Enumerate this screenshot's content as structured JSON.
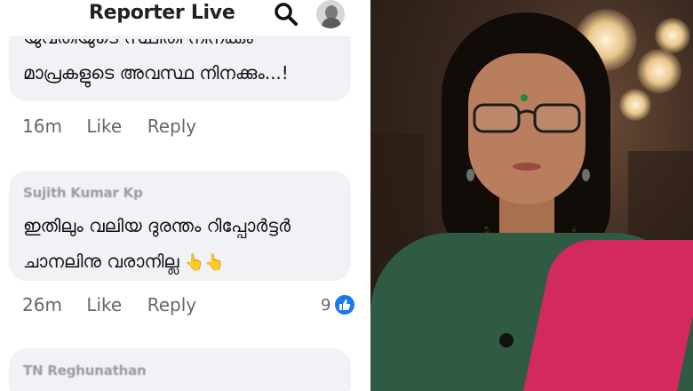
{
  "header": {
    "title": "Reporter Live",
    "search_icon": "search-icon",
    "avatar_icon": "profile-avatar"
  },
  "comments": [
    {
      "author": "",
      "text_cut": "യുവതിയുടെ സ്ഥിതി നിനക്കും",
      "text": [
        "മാപ്രകളുടെ അവസ്ഥ നിനക്കും...!"
      ],
      "time": "16m",
      "like": "Like",
      "reply": "Reply"
    },
    {
      "author": "Sujith Kumar Kp",
      "text": [
        "ഇതിലും വലിയ ദുരന്തം റിപ്പോർട്ടർ",
        "ചാനലിനു വരാനില്ല"
      ],
      "emoji": "👆👆",
      "time": "26m",
      "like": "Like",
      "reply": "Reply",
      "reaction_count": "9"
    },
    {
      "author": "TN Reghunathan"
    }
  ],
  "colors": {
    "bubble": "#f0f2f5",
    "meta": "#65676b",
    "like_badge": "#1877f2"
  }
}
